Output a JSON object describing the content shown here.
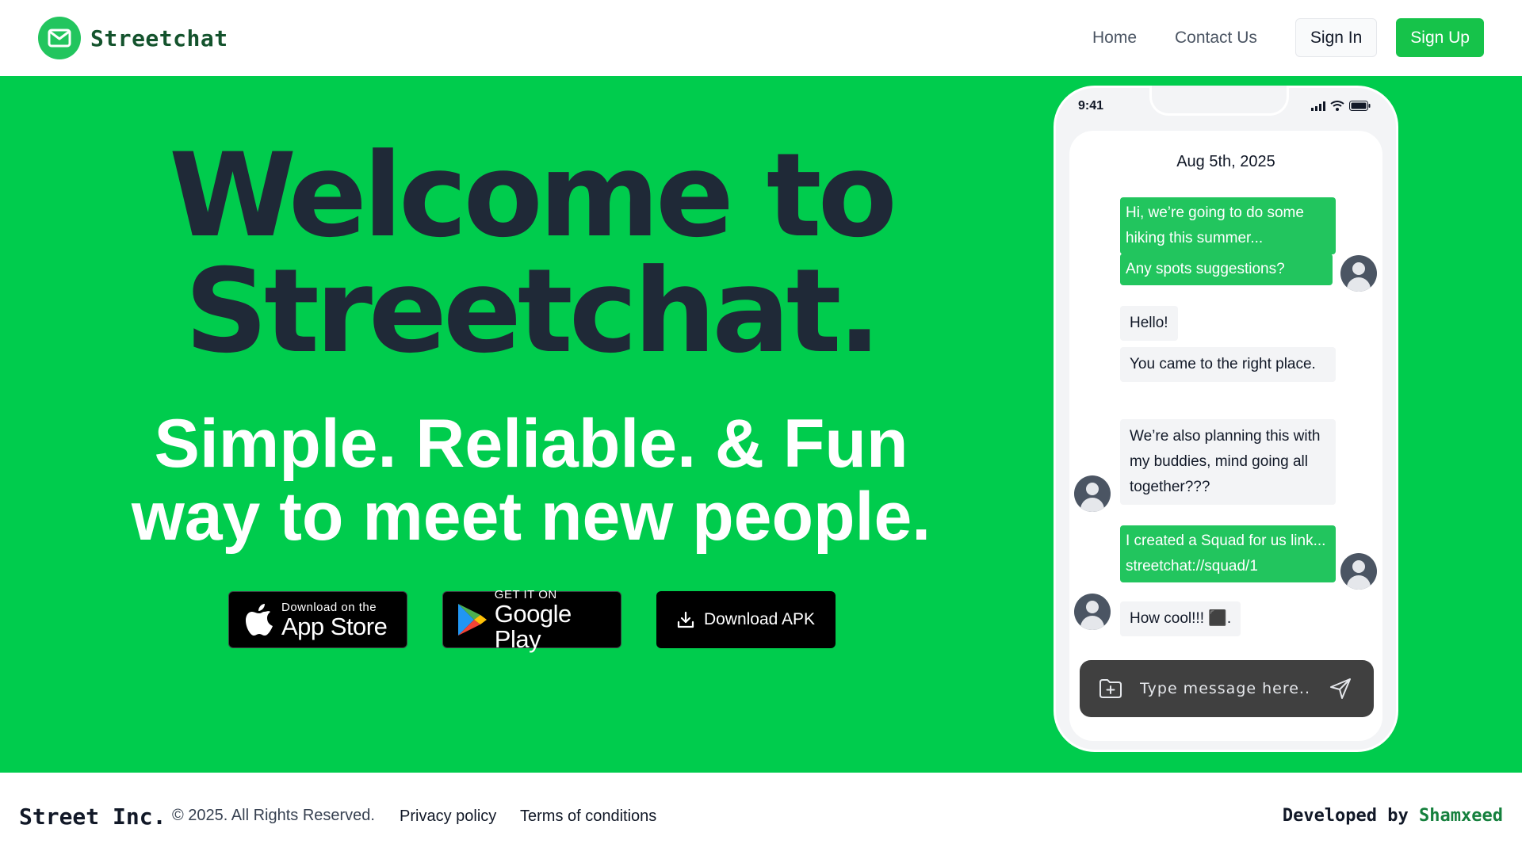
{
  "header": {
    "brand": "Streetchat",
    "nav": {
      "home": "Home",
      "contact": "Contact Us"
    },
    "sign_in": "Sign In",
    "sign_up": "Sign Up"
  },
  "hero": {
    "title_line1": "Welcome to",
    "title_line2": "Streetchat.",
    "subtitle_line1": "Simple. Reliable. & Fun",
    "subtitle_line2": "way to meet new people.",
    "app_store": {
      "small": "Download on the",
      "big": "App Store"
    },
    "google_play": {
      "small": "GET IT ON",
      "big": "Google Play"
    },
    "apk": "Download APK"
  },
  "phone": {
    "time": "9:41",
    "date": "Aug 5th, 2025",
    "messages": [
      {
        "side": "out",
        "text": "Hi, we’re going to do some hiking this summer..."
      },
      {
        "side": "out",
        "text": "Any spots suggestions?"
      },
      {
        "side": "in",
        "text": "Hello!"
      },
      {
        "side": "in",
        "text": "You came to the right place."
      },
      {
        "side": "in",
        "text": "We’re also planning this with my buddies, mind going all together???"
      },
      {
        "side": "out",
        "text": "I created a Squad for us link... streetchat://squad/1"
      },
      {
        "side": "in",
        "text": "How cool!!! ⬛."
      }
    ],
    "composer_placeholder": "Type message here.."
  },
  "footer": {
    "brand": "Street Inc.",
    "copyright": "© 2025. All Rights Reserved.",
    "privacy": "Privacy policy",
    "terms": "Terms of conditions",
    "developed_by": "Developed by",
    "author": "Shamxeed"
  },
  "colors": {
    "hero_bg": "#00cc4d",
    "accent": "#22c55e",
    "dark_text": "#1f2937",
    "composer_bg": "#404040"
  },
  "icons": [
    "envelope-icon",
    "apple-icon",
    "google-play-icon",
    "download-icon",
    "signal-icon",
    "wifi-icon",
    "battery-icon",
    "user-avatar-icon",
    "folder-plus-icon",
    "send-icon"
  ]
}
